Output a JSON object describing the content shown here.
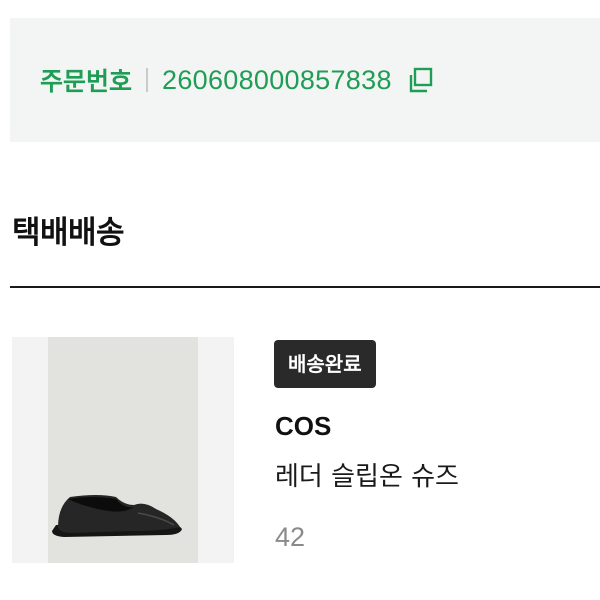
{
  "order": {
    "label": "주문번호",
    "number": "260608000857838",
    "accent_color": "#1f9d55",
    "copy_icon": "copy-icon"
  },
  "shipping": {
    "title": "택배배송"
  },
  "product": {
    "status_badge": "배송완료",
    "brand": "COS",
    "name": "레더 슬립온 슈즈",
    "size": "42",
    "image_icon": "shoe-image"
  }
}
